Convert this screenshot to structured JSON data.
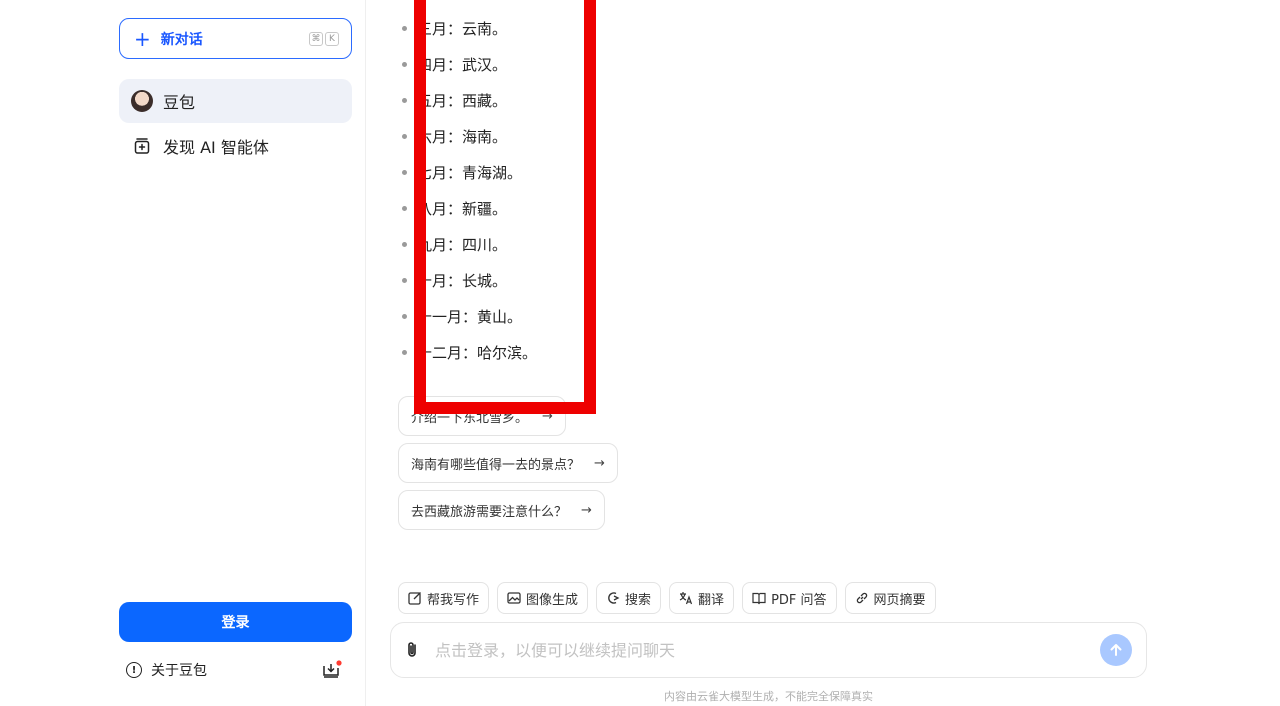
{
  "sidebar": {
    "new_chat_label": "新对话",
    "shortcut_keys": [
      "⌘",
      "K"
    ],
    "items": [
      {
        "label": "豆包"
      },
      {
        "label": "发现 AI 智能体"
      }
    ],
    "login_label": "登录",
    "about_label": "关于豆包"
  },
  "content": {
    "bullets": [
      "三月：云南。",
      "四月：武汉。",
      "五月：西藏。",
      "六月：海南。",
      "七月：青海湖。",
      "八月：新疆。",
      "九月：四川。",
      "十月：长城。",
      "十一月：黄山。",
      "十二月：哈尔滨。"
    ],
    "suggestions": [
      "介绍一下东北雪乡。",
      "海南有哪些值得一去的景点？",
      "去西藏旅游需要注意什么？"
    ],
    "arrow": "→"
  },
  "toolbar": {
    "tools": [
      {
        "label": "帮我写作",
        "icon": "edit-icon"
      },
      {
        "label": "图像生成",
        "icon": "image-icon"
      },
      {
        "label": "搜索",
        "icon": "search-icon"
      },
      {
        "label": "翻译",
        "icon": "translate-icon"
      },
      {
        "label": "PDF 问答",
        "icon": "book-icon"
      },
      {
        "label": "网页摘要",
        "icon": "link-icon"
      }
    ]
  },
  "input": {
    "placeholder": "点击登录，以便可以继续提问聊天"
  },
  "footer": {
    "disclaimer": "内容由云雀大模型生成，不能完全保障真实"
  },
  "colors": {
    "accent": "#0b67ff",
    "highlight_box": "#ee0000"
  }
}
